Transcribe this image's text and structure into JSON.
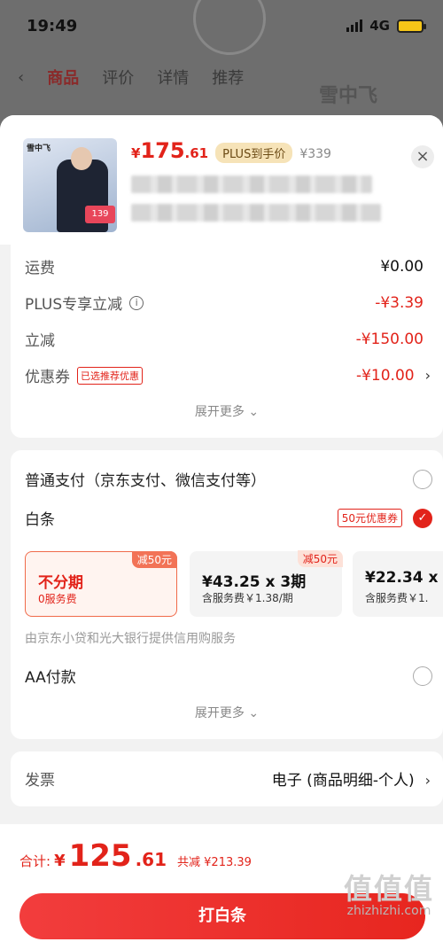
{
  "status_bar": {
    "time": "19:49",
    "network": "4G"
  },
  "background": {
    "tabs": [
      "商品",
      "评价",
      "详情",
      "推荐"
    ],
    "brand": "雪中飞"
  },
  "product": {
    "thumb_brand": "雪中飞",
    "thumb_tag": "139",
    "price_symbol": "¥",
    "price_int": "175",
    "price_dec": ".61",
    "plus_badge": "PLUS到手价",
    "original_price": "¥339",
    "close": "×"
  },
  "fees": {
    "rows": [
      {
        "label": "运费",
        "value": "¥0.00"
      },
      {
        "label": "PLUS专享立减",
        "value": "-¥3.39"
      },
      {
        "label": "立减",
        "value": "-¥150.00"
      },
      {
        "label": "优惠券",
        "tag": "已选推荐优惠",
        "value": "-¥10.00"
      }
    ],
    "expand": "展开更多 ⌄"
  },
  "payment": {
    "normal": "普通支付（京东支付、微信支付等）",
    "baitiao": "白条",
    "baitiao_tag": "50元优惠券",
    "plans": [
      {
        "main": "不分期",
        "sub": "0服务费",
        "badge": "减50元"
      },
      {
        "main": "¥43.25 x 3期",
        "sub": "含服务费￥1.38/期",
        "badge": "减50元"
      },
      {
        "main": "¥22.34 x",
        "sub": "含服务费￥1."
      }
    ],
    "provider": "由京东小贷和光大银行提供信用购服务",
    "aa": "AA付款",
    "expand": "展开更多 ⌄"
  },
  "invoice": {
    "label": "发票",
    "value": "电子 (商品明细-个人)"
  },
  "footer": {
    "total_label": "合计:",
    "total_symbol": "¥",
    "total_int": "125",
    "total_dec": ".61",
    "total_saved": "共减 ¥213.39",
    "pay_button": "打白条"
  },
  "watermark": {
    "logo": "值值值",
    "url": "zhizhizhi.com"
  },
  "colors": {
    "accent": "#e2231a",
    "plus_badge": "#f6e3b8"
  }
}
